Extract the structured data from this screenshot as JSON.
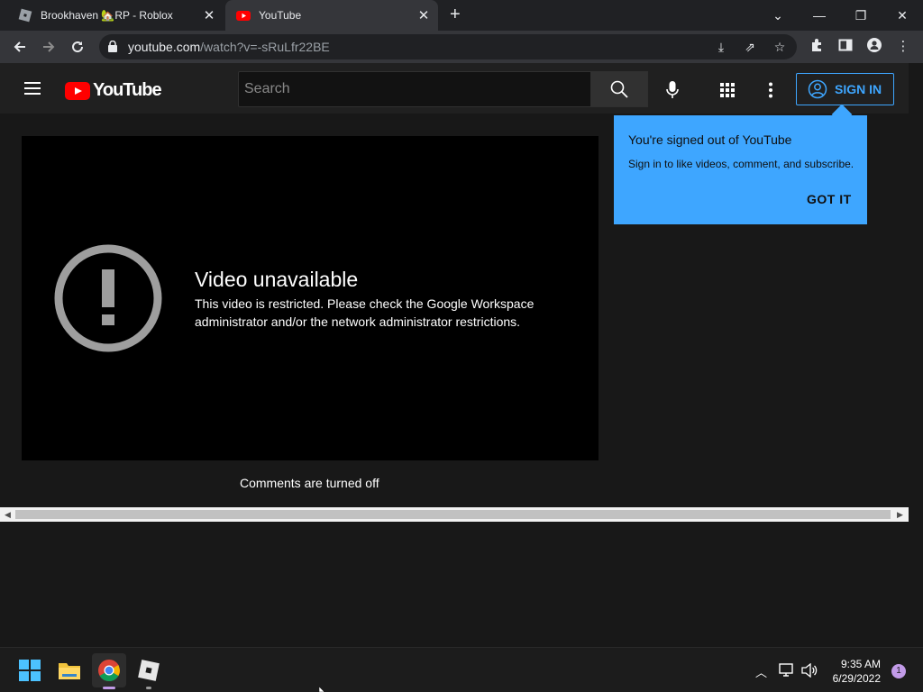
{
  "browser": {
    "tabs": [
      {
        "title": "Brookhaven 🏡RP - Roblox",
        "active": false
      },
      {
        "title": "YouTube",
        "active": true
      }
    ],
    "url_host": "youtube.com",
    "url_path": "/watch?v=-sRuLfr22BE"
  },
  "youtube": {
    "logo_text": "YouTube",
    "search_placeholder": "Search",
    "sign_in_label": "SIGN IN"
  },
  "player": {
    "error_title": "Video unavailable",
    "error_message": "This video is restricted. Please check the Google Workspace administrator and/or the network administrator restrictions."
  },
  "comments_status": "Comments are turned off",
  "tooltip": {
    "title": "You're signed out of YouTube",
    "body": "Sign in to like videos, comment, and subscribe.",
    "button": "GOT IT"
  },
  "taskbar": {
    "time": "9:35 AM",
    "date": "6/29/2022",
    "notification_count": "1"
  },
  "colors": {
    "accent": "#3ea6ff",
    "youtube_red": "#ff0000",
    "background": "#181818"
  }
}
